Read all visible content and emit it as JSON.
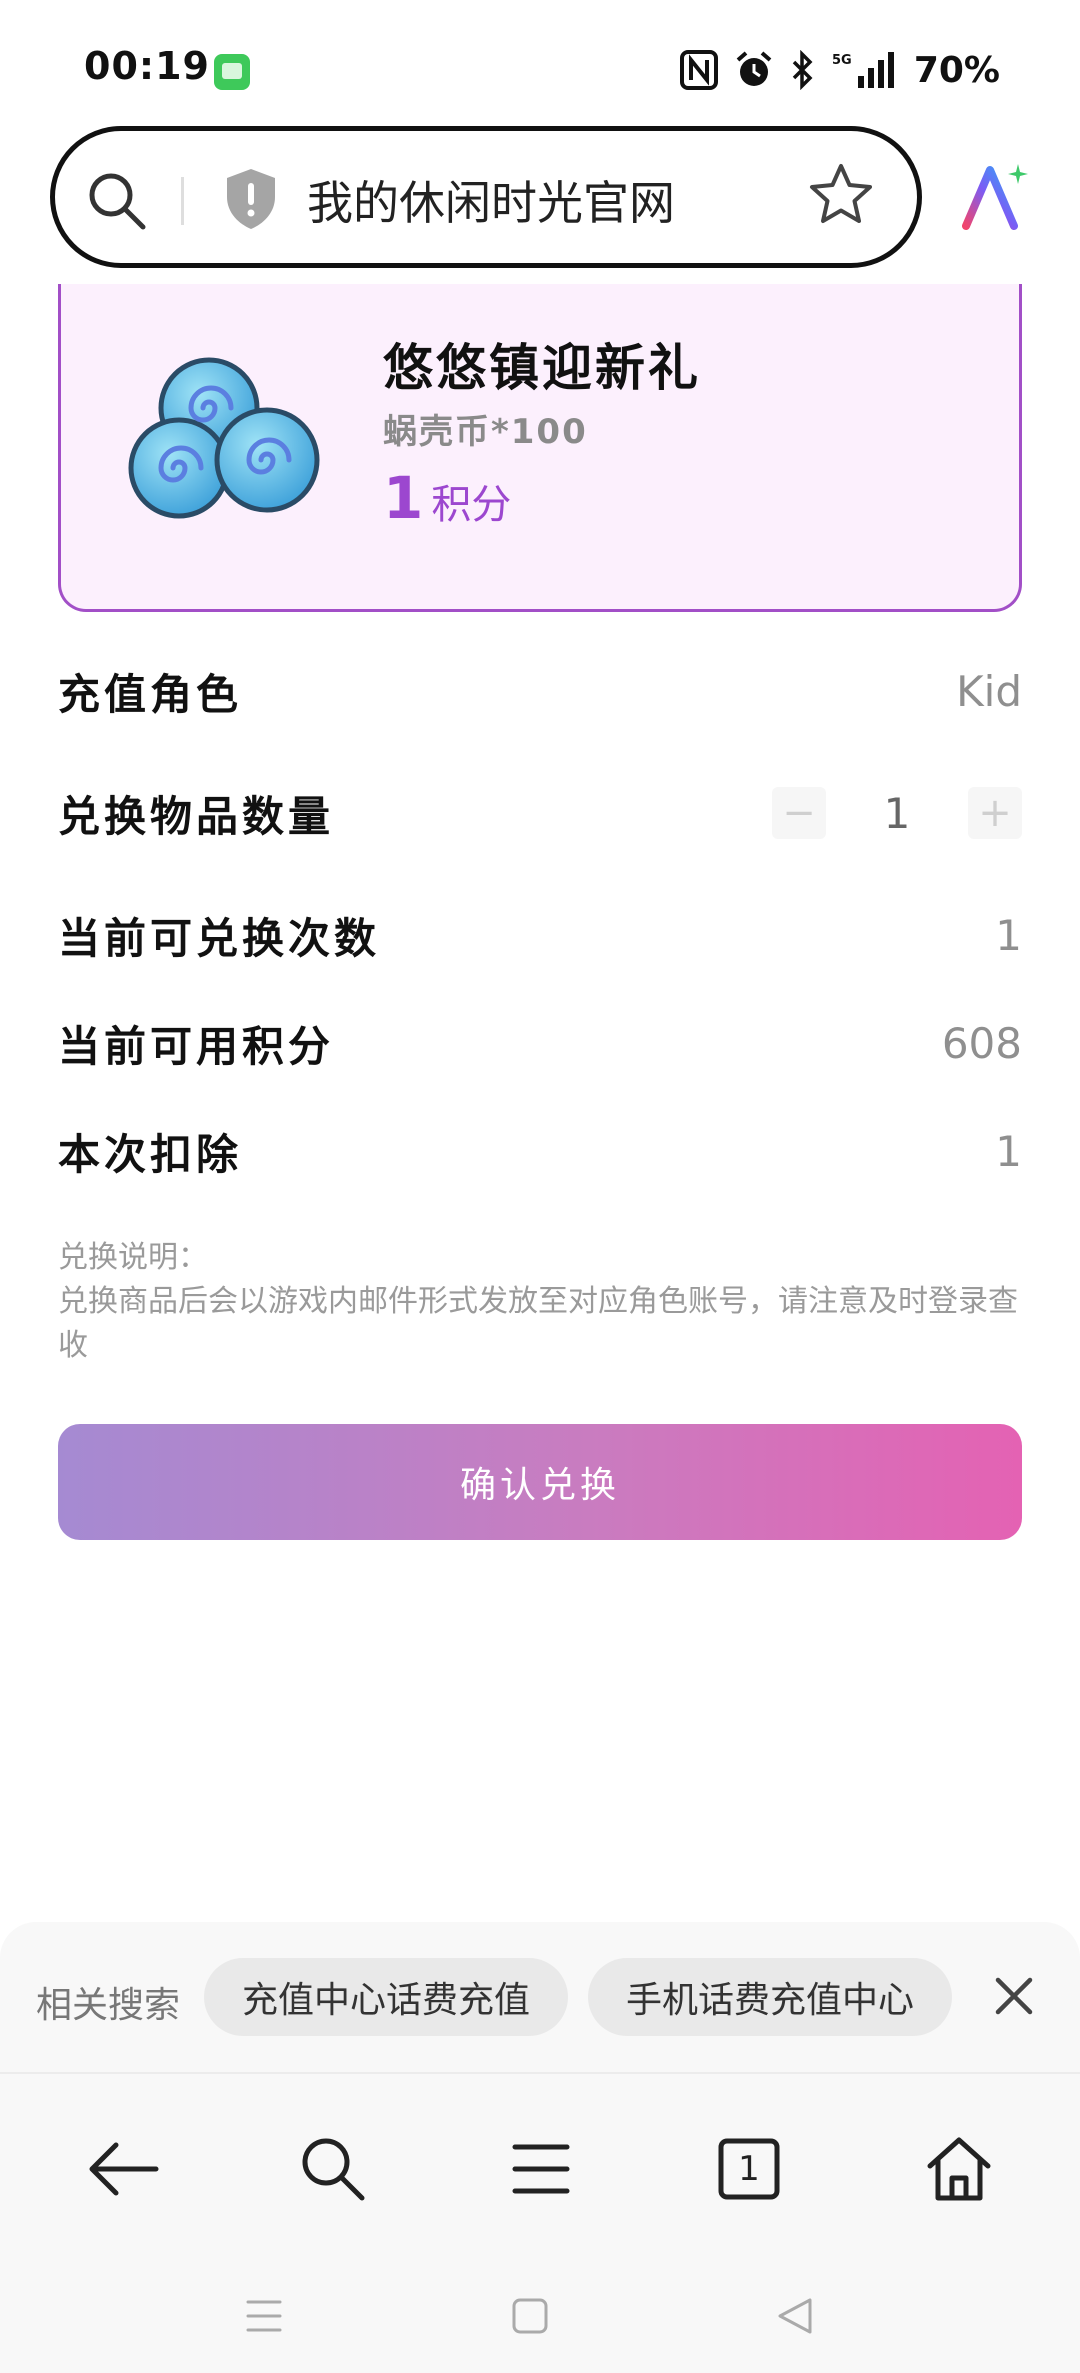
{
  "status_bar": {
    "time": "00:19",
    "signal_label": "5G",
    "battery": "70%",
    "icons": [
      "message-icon",
      "nfc-icon",
      "alarm-icon",
      "bluetooth-icon",
      "signal-icon"
    ]
  },
  "browser": {
    "url_title": "我的休闲时光官网",
    "icons": [
      "search-icon",
      "shield-icon",
      "star-icon",
      "ai-assistant-icon"
    ]
  },
  "product": {
    "title": "悠悠镇迎新礼",
    "subtitle": "蜗壳币*100",
    "price_value": "1",
    "price_unit": "积分",
    "icon": "snail-coin-icon"
  },
  "rows": {
    "role": {
      "label": "充值角色",
      "value": "Kid"
    },
    "quantity": {
      "label": "兑换物品数量",
      "value": "1",
      "minus": "−",
      "plus": "+"
    },
    "remaining": {
      "label": "当前可兑换次数",
      "value": "1"
    },
    "points": {
      "label": "当前可用积分",
      "value": "608"
    },
    "deduct": {
      "label": "本次扣除",
      "value": "1"
    }
  },
  "note": {
    "title": "兑换说明：",
    "text": "兑换商品后会以游戏内邮件形式发放至对应角色账号，请注意及时登录查收"
  },
  "confirm_label": "确认兑换",
  "colors": {
    "accent_purple": "#9c47cf",
    "card_border": "#a24fc7",
    "card_bg": "#fcf0fd",
    "gradient_start": "#a58ad2",
    "gradient_end": "#e462b3"
  },
  "related": {
    "label": "相关搜索",
    "chips": [
      "充值中心话费充值",
      "手机话费充值中心"
    ]
  },
  "toolbar": {
    "tab_count": "1",
    "icons": [
      "back-arrow-icon",
      "search-icon",
      "menu-icon",
      "tabs-icon",
      "home-icon"
    ]
  },
  "system_nav": {
    "icons": [
      "recents-icon",
      "home-square-icon",
      "back-triangle-icon"
    ]
  }
}
